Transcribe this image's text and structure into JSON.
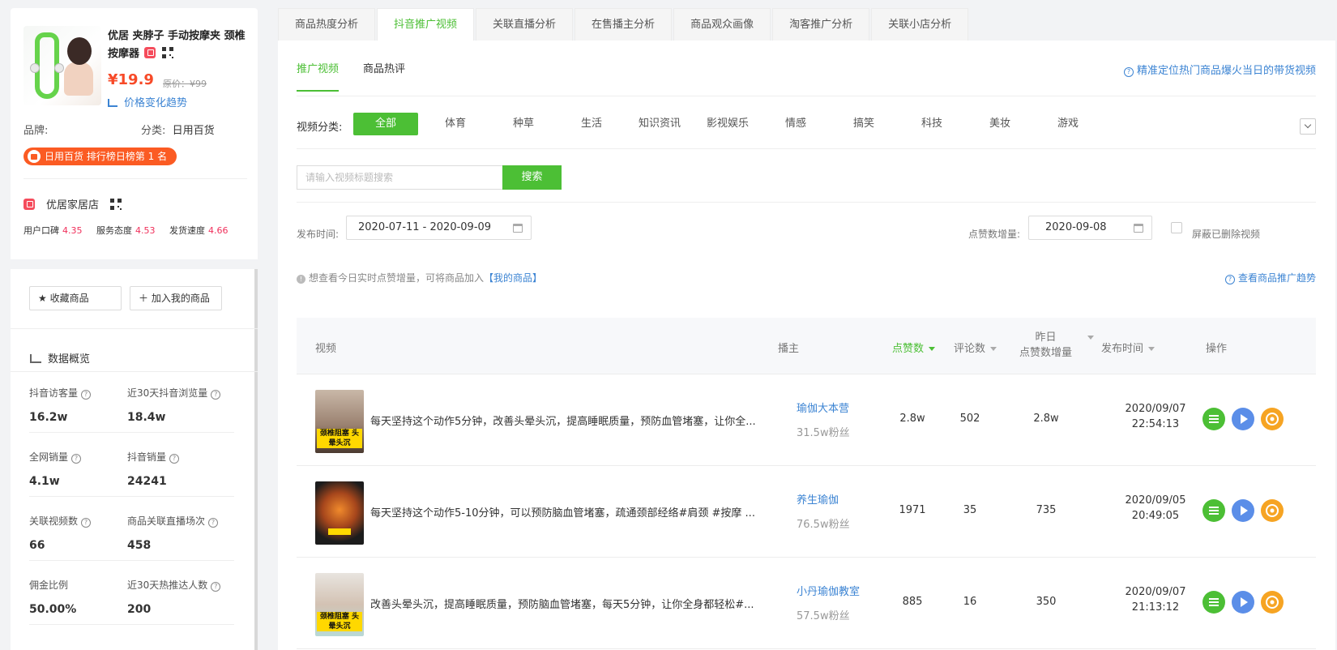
{
  "product": {
    "title": "优居 夹脖子 手动按摩夹 颈椎按摩器",
    "price": "¥19.9",
    "original_price": "原价：¥99",
    "price_trend_link": "价格变化趋势",
    "brand_label": "品牌:",
    "category_label": "分类:",
    "category_value": "日用百货",
    "rank_badge": "日用百货 排行榜日榜第 1 名"
  },
  "shop": {
    "name": "优居家居店",
    "scores": [
      {
        "label": "用户口碑",
        "value": "4.35"
      },
      {
        "label": "服务态度",
        "value": "4.53"
      },
      {
        "label": "发货速度",
        "value": "4.66"
      }
    ]
  },
  "actions": {
    "favorite": "收藏商品",
    "add_mine": "加入我的商品"
  },
  "overview": {
    "title": "数据概览",
    "stats": [
      {
        "label": "抖音访客量",
        "value": "16.2w"
      },
      {
        "label": "近30天抖音浏览量",
        "value": "18.4w"
      },
      {
        "label": "全网销量",
        "value": "4.1w"
      },
      {
        "label": "抖音销量",
        "value": "24241"
      },
      {
        "label": "关联视频数",
        "value": "66"
      },
      {
        "label": "商品关联直播场次",
        "value": "458"
      },
      {
        "label": "佣金比例",
        "value": "50.00%"
      },
      {
        "label": "近30天热推达人数",
        "value": "200"
      }
    ]
  },
  "tabs": [
    "商品热度分析",
    "抖音推广视频",
    "关联直播分析",
    "在售播主分析",
    "商品观众画像",
    "淘客推广分析",
    "关联小店分析"
  ],
  "active_tab": 1,
  "subtabs": [
    "推广视频",
    "商品热评"
  ],
  "help_link": "精准定位热门商品爆火当日的带货视频",
  "filter": {
    "label": "视频分类:",
    "categories": [
      "全部",
      "体育",
      "种草",
      "生活",
      "知识资讯",
      "影视娱乐",
      "情感",
      "搞笑",
      "科技",
      "美妆",
      "游戏"
    ]
  },
  "search": {
    "placeholder": "请输入视频标题搜索",
    "button": "搜索"
  },
  "date_filter": {
    "publish_label": "发布时间:",
    "publish_range": "2020-07-11 - 2020-09-09",
    "likes_label": "点赞数增量:",
    "likes_date": "2020-09-08",
    "hide_deleted": "屏蔽已删除视频"
  },
  "notice": {
    "text": "想查看今日实时点赞增量，可将商品加入",
    "link": "【我的商品】",
    "trend_link": "查看商品推广趋势"
  },
  "table": {
    "headers": {
      "video": "视频",
      "anchor": "播主",
      "likes": "点赞数",
      "comments": "评论数",
      "yesterday_1": "昨日",
      "yesterday_2": "点赞数增量",
      "publish": "发布时间",
      "ops": "操作"
    },
    "rows": [
      {
        "title": "每天坚持这个动作5分钟，改善头晕头沉，提高睡眠质量，预防血管堵塞，让你全...",
        "thumb_caption": "颈椎阻塞 头晕头沉",
        "anchor": "瑜伽大本营",
        "fans": "31.5w粉丝",
        "likes": "2.8w",
        "comments": "502",
        "increase": "2.8w",
        "date": "2020/09/07",
        "time": "22:54:13"
      },
      {
        "title": "每天坚持这个动作5-10分钟，可以预防脑血管堵塞，疏通颈部经络#肩颈 #按摩 ...",
        "thumb_caption": "",
        "anchor": "养生瑜伽",
        "fans": "76.5w粉丝",
        "likes": "1971",
        "comments": "35",
        "increase": "735",
        "date": "2020/09/05",
        "time": "20:49:05"
      },
      {
        "title": "改善头晕头沉，提高睡眠质量，预防脑血管堵塞，每天5分钟，让你全身都轻松#...",
        "thumb_caption": "颈椎阻塞 头晕头沉",
        "anchor": "小丹瑜伽教室",
        "fans": "57.5w粉丝",
        "likes": "885",
        "comments": "16",
        "increase": "350",
        "date": "2020/09/07",
        "time": "21:13:12"
      }
    ]
  },
  "colors": {
    "accent": "#4cbf35",
    "price": "#f74a28",
    "link": "#3c84d3",
    "rank_badge": "#fb5b23",
    "score": "#f0305b"
  }
}
